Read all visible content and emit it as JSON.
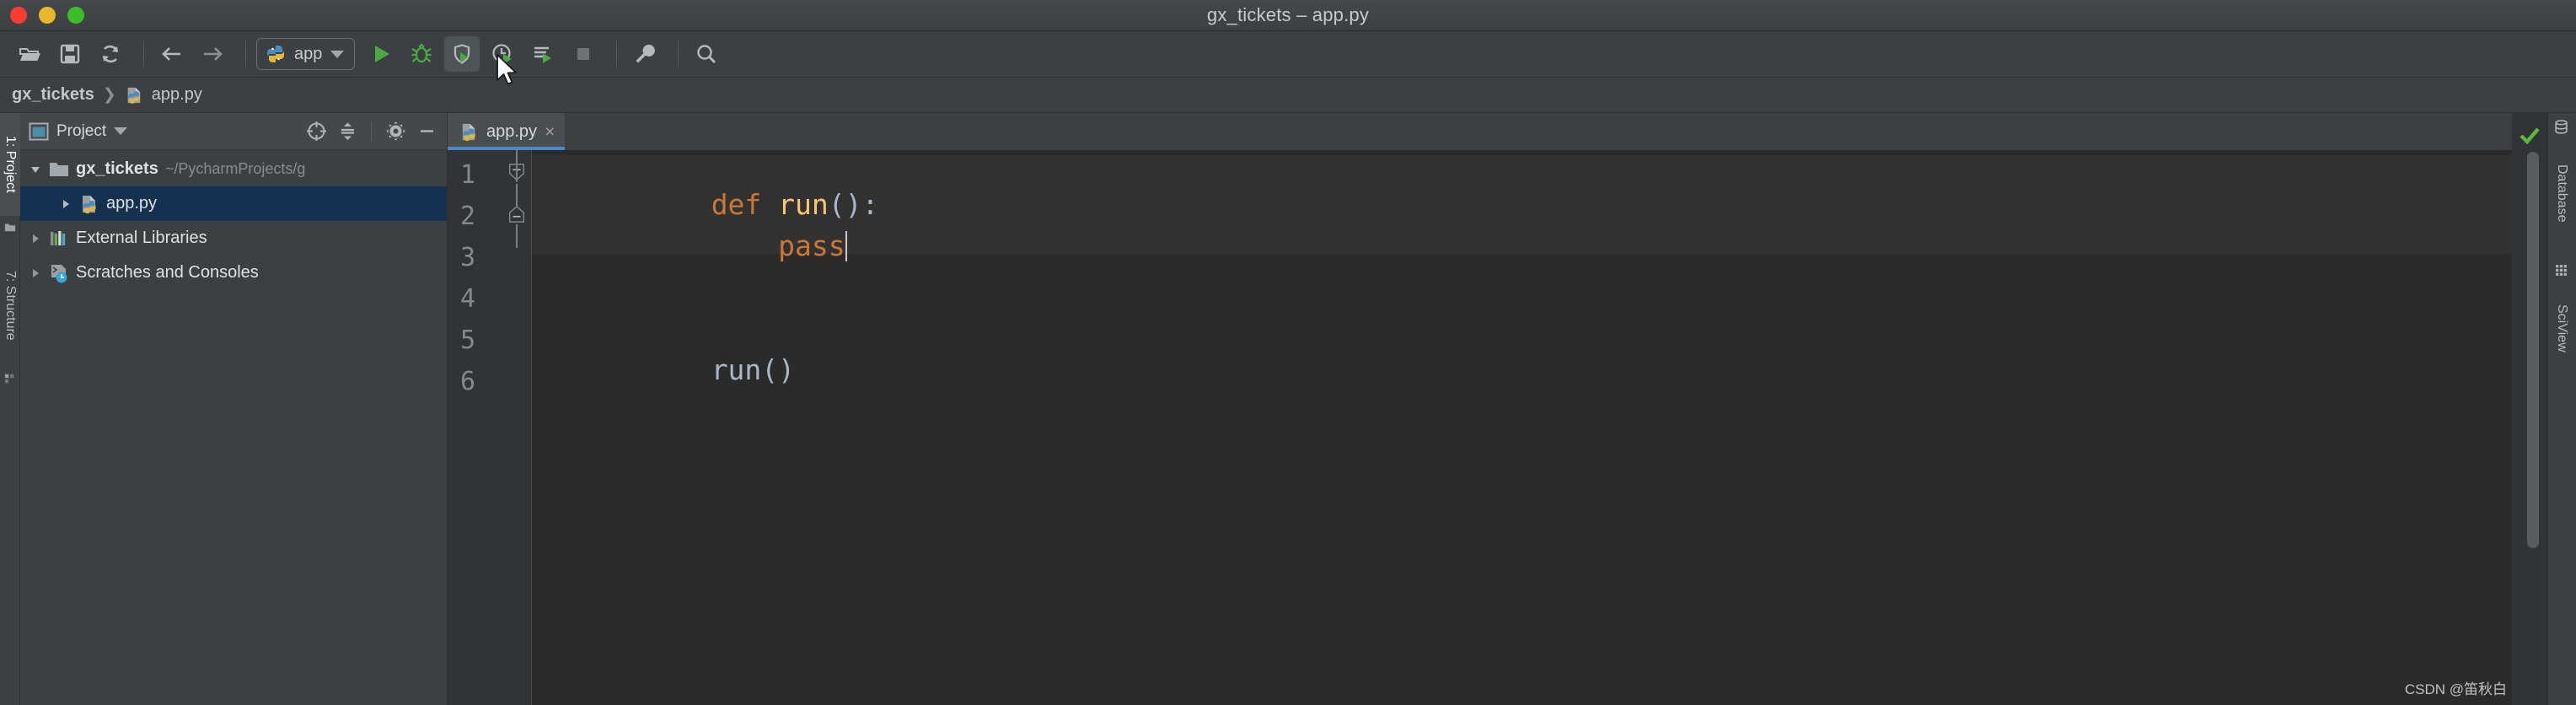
{
  "window": {
    "title": "gx_tickets – app.py",
    "controls": [
      {
        "name": "close",
        "color": "#ff3b33"
      },
      {
        "name": "minimize",
        "color": "#e8b92e"
      },
      {
        "name": "zoom",
        "color": "#3bbf26"
      }
    ]
  },
  "toolbar": {
    "buttons": [
      {
        "icon": "open-folder-icon",
        "label": "Open"
      },
      {
        "icon": "save-icon",
        "label": "Save All"
      },
      {
        "icon": "sync-icon",
        "label": "Synchronize"
      },
      {
        "icon": "back-arrow-icon",
        "label": "Back"
      },
      {
        "icon": "forward-arrow-icon",
        "label": "Forward"
      }
    ],
    "run_config": {
      "icon": "python-file-icon",
      "label": "app",
      "dropdown": "chevron-down-icon"
    },
    "run_buttons": [
      {
        "icon": "run-icon",
        "label": "Run"
      },
      {
        "icon": "debug-icon",
        "label": "Debug"
      },
      {
        "icon": "coverage-icon",
        "label": "Run with Coverage",
        "active": true
      },
      {
        "icon": "profile-icon",
        "label": "Profile"
      },
      {
        "icon": "run-console-icon",
        "label": "Run with Console"
      },
      {
        "icon": "stop-icon",
        "label": "Stop"
      }
    ],
    "right_buttons": [
      {
        "icon": "wrench-icon",
        "label": "Settings"
      },
      {
        "icon": "search-icon",
        "label": "Search Everywhere"
      }
    ]
  },
  "breadcrumb": {
    "project": "gx_tickets",
    "separator": "❯",
    "file": "app.py",
    "file_icon": "python-file-icon"
  },
  "left_tool_tabs": [
    {
      "label": "1: Project",
      "icon": "folder-icon",
      "selected": true
    },
    {
      "label": "7: Structure",
      "icon": "structure-icon",
      "selected": false
    }
  ],
  "project_panel": {
    "title": "Project",
    "title_icon": "project-window-icon",
    "dropdown": "chevron-down-icon",
    "actions": [
      {
        "icon": "locate-target-icon",
        "label": "Select Opened File"
      },
      {
        "icon": "collapse-all-icon",
        "label": "Collapse All"
      },
      {
        "icon": "gear-icon",
        "label": "Options"
      },
      {
        "icon": "minimize-icon",
        "label": "Hide"
      }
    ],
    "tree": [
      {
        "label": "gx_tickets",
        "path": "~/PycharmProjects/g",
        "icon": "folder-icon",
        "arrow": "expanded",
        "depth": 0,
        "bold": true,
        "selected": false
      },
      {
        "label": "app.py",
        "path": "",
        "icon": "python-file-icon",
        "arrow": "collapsed",
        "depth": 1,
        "bold": false,
        "selected": true
      },
      {
        "label": "External Libraries",
        "path": "",
        "icon": "libraries-icon",
        "arrow": "collapsed",
        "depth": 0,
        "bold": false,
        "selected": false
      },
      {
        "label": "Scratches and Consoles",
        "path": "",
        "icon": "scratches-icon",
        "arrow": "collapsed",
        "depth": 0,
        "bold": false,
        "selected": false
      }
    ]
  },
  "editor": {
    "tabs": [
      {
        "label": "app.py",
        "icon": "python-file-icon",
        "close": "×",
        "active": true
      }
    ],
    "line_numbers": [
      "1",
      "2",
      "3",
      "4",
      "5",
      "6"
    ],
    "lines": [
      {
        "number": "1",
        "highlighted": true,
        "fold": "fold-start",
        "tokens": [
          {
            "text": "def ",
            "type": "keyword"
          },
          {
            "text": "run",
            "type": "function-name"
          },
          {
            "text": "():",
            "type": "punctuation"
          }
        ]
      },
      {
        "number": "2",
        "highlighted": false,
        "fold": "fold-end",
        "caret": true,
        "tokens": [
          {
            "text": "    pass",
            "type": "keyword"
          }
        ]
      },
      {
        "number": "3",
        "highlighted": false,
        "fold": "",
        "tokens": []
      },
      {
        "number": "4",
        "highlighted": false,
        "fold": "",
        "tokens": []
      },
      {
        "number": "5",
        "highlighted": false,
        "fold": "",
        "tokens": [
          {
            "text": "run()",
            "type": "identifier"
          }
        ]
      },
      {
        "number": "6",
        "highlighted": false,
        "fold": "",
        "tokens": []
      }
    ],
    "inspection_status": "ok-check-icon"
  },
  "right_tool_tabs": [
    {
      "label": "Database",
      "icon": "database-icon"
    },
    {
      "label": "SciView",
      "icon": "sciview-grid-icon"
    }
  ],
  "watermark": "CSDN @笛秋白",
  "colors": {
    "accent_blue": "#4a88c7",
    "selection_blue": "#14324f",
    "keyword_orange": "#cc7832",
    "function_yellow": "#ffc66d",
    "identifier_gray": "#a9b7c6",
    "editor_bg": "#2b2b2b",
    "panel_bg": "#3c4043",
    "run_green": "#49a942"
  }
}
